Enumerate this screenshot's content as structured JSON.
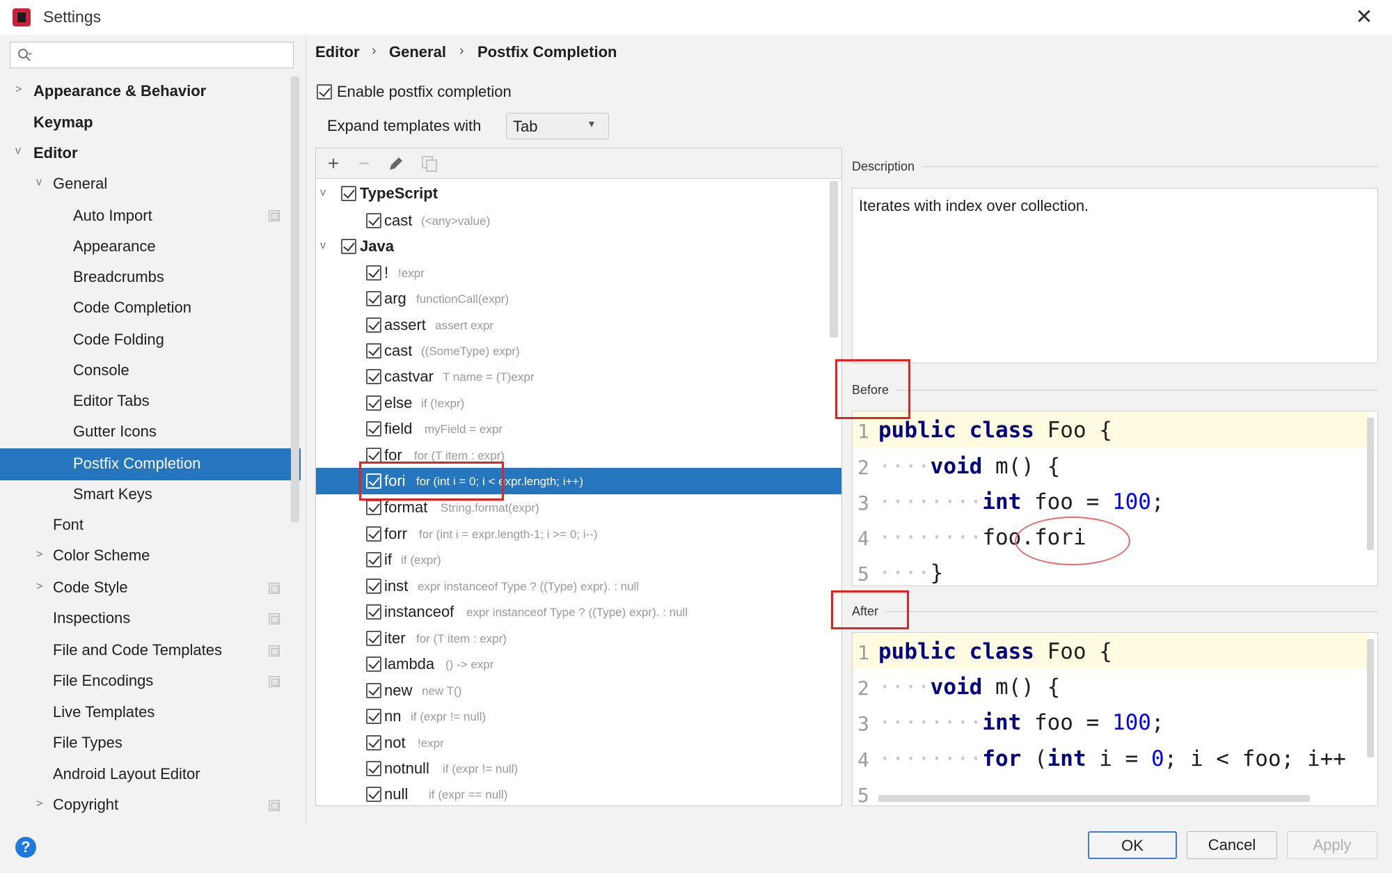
{
  "window": {
    "title": "Settings",
    "close": "✕"
  },
  "search": {
    "placeholder": ""
  },
  "sidebar": {
    "items": [
      {
        "label": "Appearance & Behavior"
      },
      {
        "label": "Keymap"
      },
      {
        "label": "Editor"
      },
      {
        "label": "General"
      },
      {
        "label": "Auto Import"
      },
      {
        "label": "Appearance"
      },
      {
        "label": "Breadcrumbs"
      },
      {
        "label": "Code Completion"
      },
      {
        "label": "Code Folding"
      },
      {
        "label": "Console"
      },
      {
        "label": "Editor Tabs"
      },
      {
        "label": "Gutter Icons"
      },
      {
        "label": "Postfix Completion"
      },
      {
        "label": "Smart Keys"
      },
      {
        "label": "Font"
      },
      {
        "label": "Color Scheme"
      },
      {
        "label": "Code Style"
      },
      {
        "label": "Inspections"
      },
      {
        "label": "File and Code Templates"
      },
      {
        "label": "File Encodings"
      },
      {
        "label": "Live Templates"
      },
      {
        "label": "File Types"
      },
      {
        "label": "Android Layout Editor"
      },
      {
        "label": "Copyright"
      }
    ],
    "selected": "Postfix Completion"
  },
  "breadcrumb": {
    "items": [
      "Editor",
      "General",
      "Postfix Completion"
    ],
    "separator": "›"
  },
  "options": {
    "enable_label": "Enable postfix completion",
    "enable_checked": true,
    "expand_label": "Expand templates with",
    "expand_value": "Tab"
  },
  "toolbar": {
    "add": "+",
    "remove": "−"
  },
  "templates": {
    "groups": [
      {
        "name": "TypeScript",
        "checked": true
      },
      {
        "name": "Java",
        "checked": true
      }
    ],
    "items": [
      {
        "name": "cast",
        "desc": "(<any>value)"
      },
      {
        "name": "!",
        "desc": "!expr"
      },
      {
        "name": "arg",
        "desc": "functionCall(expr)"
      },
      {
        "name": "assert",
        "desc": "assert expr"
      },
      {
        "name": "cast",
        "desc": "((SomeType) expr)"
      },
      {
        "name": "castvar",
        "desc": "T name = (T)expr"
      },
      {
        "name": "else",
        "desc": "if (!expr)"
      },
      {
        "name": "field",
        "desc": "myField = expr"
      },
      {
        "name": "for",
        "desc": "for (T item : expr)"
      },
      {
        "name": "fori",
        "desc": "for (int i = 0; i < expr.length; i++)"
      },
      {
        "name": "format",
        "desc": "String.format(expr)"
      },
      {
        "name": "forr",
        "desc": "for (int i = expr.length-1; i >= 0; i--)"
      },
      {
        "name": "if",
        "desc": "if (expr)"
      },
      {
        "name": "inst",
        "desc": "expr instanceof Type ? ((Type) expr). : null"
      },
      {
        "name": "instanceof",
        "desc": "expr instanceof Type ? ((Type) expr). : null"
      },
      {
        "name": "iter",
        "desc": "for (T item : expr)"
      },
      {
        "name": "lambda",
        "desc": "() -> expr"
      },
      {
        "name": "new",
        "desc": "new T()"
      },
      {
        "name": "nn",
        "desc": "if (expr != null)"
      },
      {
        "name": "not",
        "desc": "!expr"
      },
      {
        "name": "notnull",
        "desc": "if (expr != null)"
      },
      {
        "name": "null",
        "desc": "if (expr == null)"
      }
    ],
    "selected": "fori"
  },
  "description": {
    "title": "Description",
    "text": "Iterates with index over collection."
  },
  "before": {
    "title": "Before",
    "line_numbers": [
      "1",
      "2",
      "3",
      "4",
      "5"
    ],
    "lines": [
      {
        "kw1": "public",
        "kw2": "class",
        "rest": " Foo {"
      },
      {
        "kw1": "void",
        "rest": " m() {"
      },
      {
        "kw1": "int",
        "rest": " foo = ",
        "num": "100",
        "end": ";"
      },
      {
        "rest": "foo.fori"
      },
      {
        "rest": "}"
      }
    ]
  },
  "after": {
    "title": "After",
    "line_numbers": [
      "1",
      "2",
      "3",
      "4",
      "5"
    ],
    "lines": [
      {
        "kw1": "public",
        "kw2": "class",
        "rest": " Foo {"
      },
      {
        "kw1": "void",
        "rest": " m() {"
      },
      {
        "kw1": "int",
        "rest": " foo = ",
        "num": "100",
        "end": ";"
      },
      {
        "kw1": "for",
        "rest": " (",
        "kw2": "int",
        "rest2": " i = ",
        "num": "0",
        "end": "; i < foo; i++"
      },
      {
        "rest": ""
      }
    ]
  },
  "footer": {
    "help": "?",
    "ok": "OK",
    "cancel": "Cancel",
    "apply": "Apply"
  },
  "colors": {
    "selection": "#2675bf",
    "keyword": "#000080",
    "number": "#0000ff",
    "annotation_red": "#e02424"
  }
}
